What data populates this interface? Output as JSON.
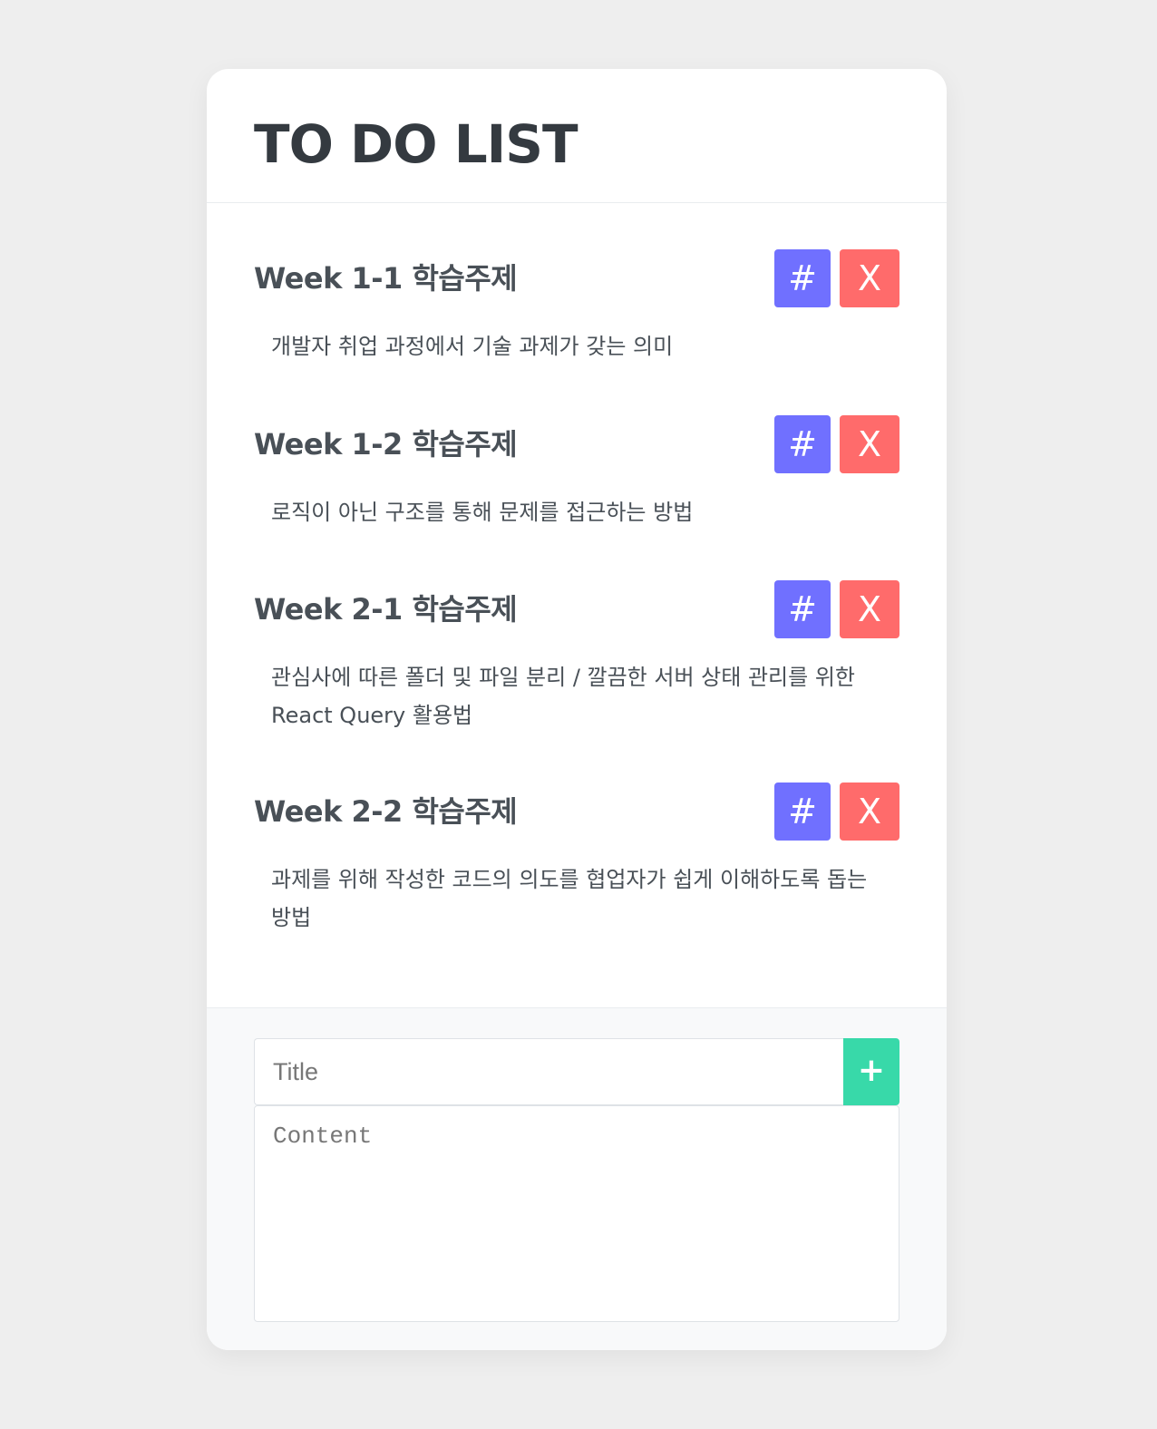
{
  "header": {
    "title": "TO DO LIST"
  },
  "todos": [
    {
      "title": "Week 1-1 학습주제",
      "content": "개발자 취업 과정에서 기술 과제가 갖는 의미",
      "edit_label": "#",
      "delete_label": "X"
    },
    {
      "title": "Week 1-2 학습주제",
      "content": "로직이 아닌 구조를 통해 문제를 접근하는 방법",
      "edit_label": "#",
      "delete_label": "X"
    },
    {
      "title": "Week 2-1 학습주제",
      "content": "관심사에 따른 폴더 및 파일 분리 / 깔끔한 서버 상태 관리를 위한 React Query 활용법",
      "edit_label": "#",
      "delete_label": "X"
    },
    {
      "title": "Week 2-2 학습주제",
      "content": "과제를 위해 작성한 코드의 의도를 협업자가 쉽게 이해하도록 돕는 방법",
      "edit_label": "#",
      "delete_label": "X"
    }
  ],
  "form": {
    "title_value": "",
    "title_placeholder": "Title",
    "content_value": "",
    "content_placeholder": "Content",
    "add_label": "+"
  },
  "colors": {
    "edit_button": "#7070ff",
    "delete_button": "#ff6b6b",
    "add_button": "#38d9a9",
    "background": "#eeeeee"
  }
}
